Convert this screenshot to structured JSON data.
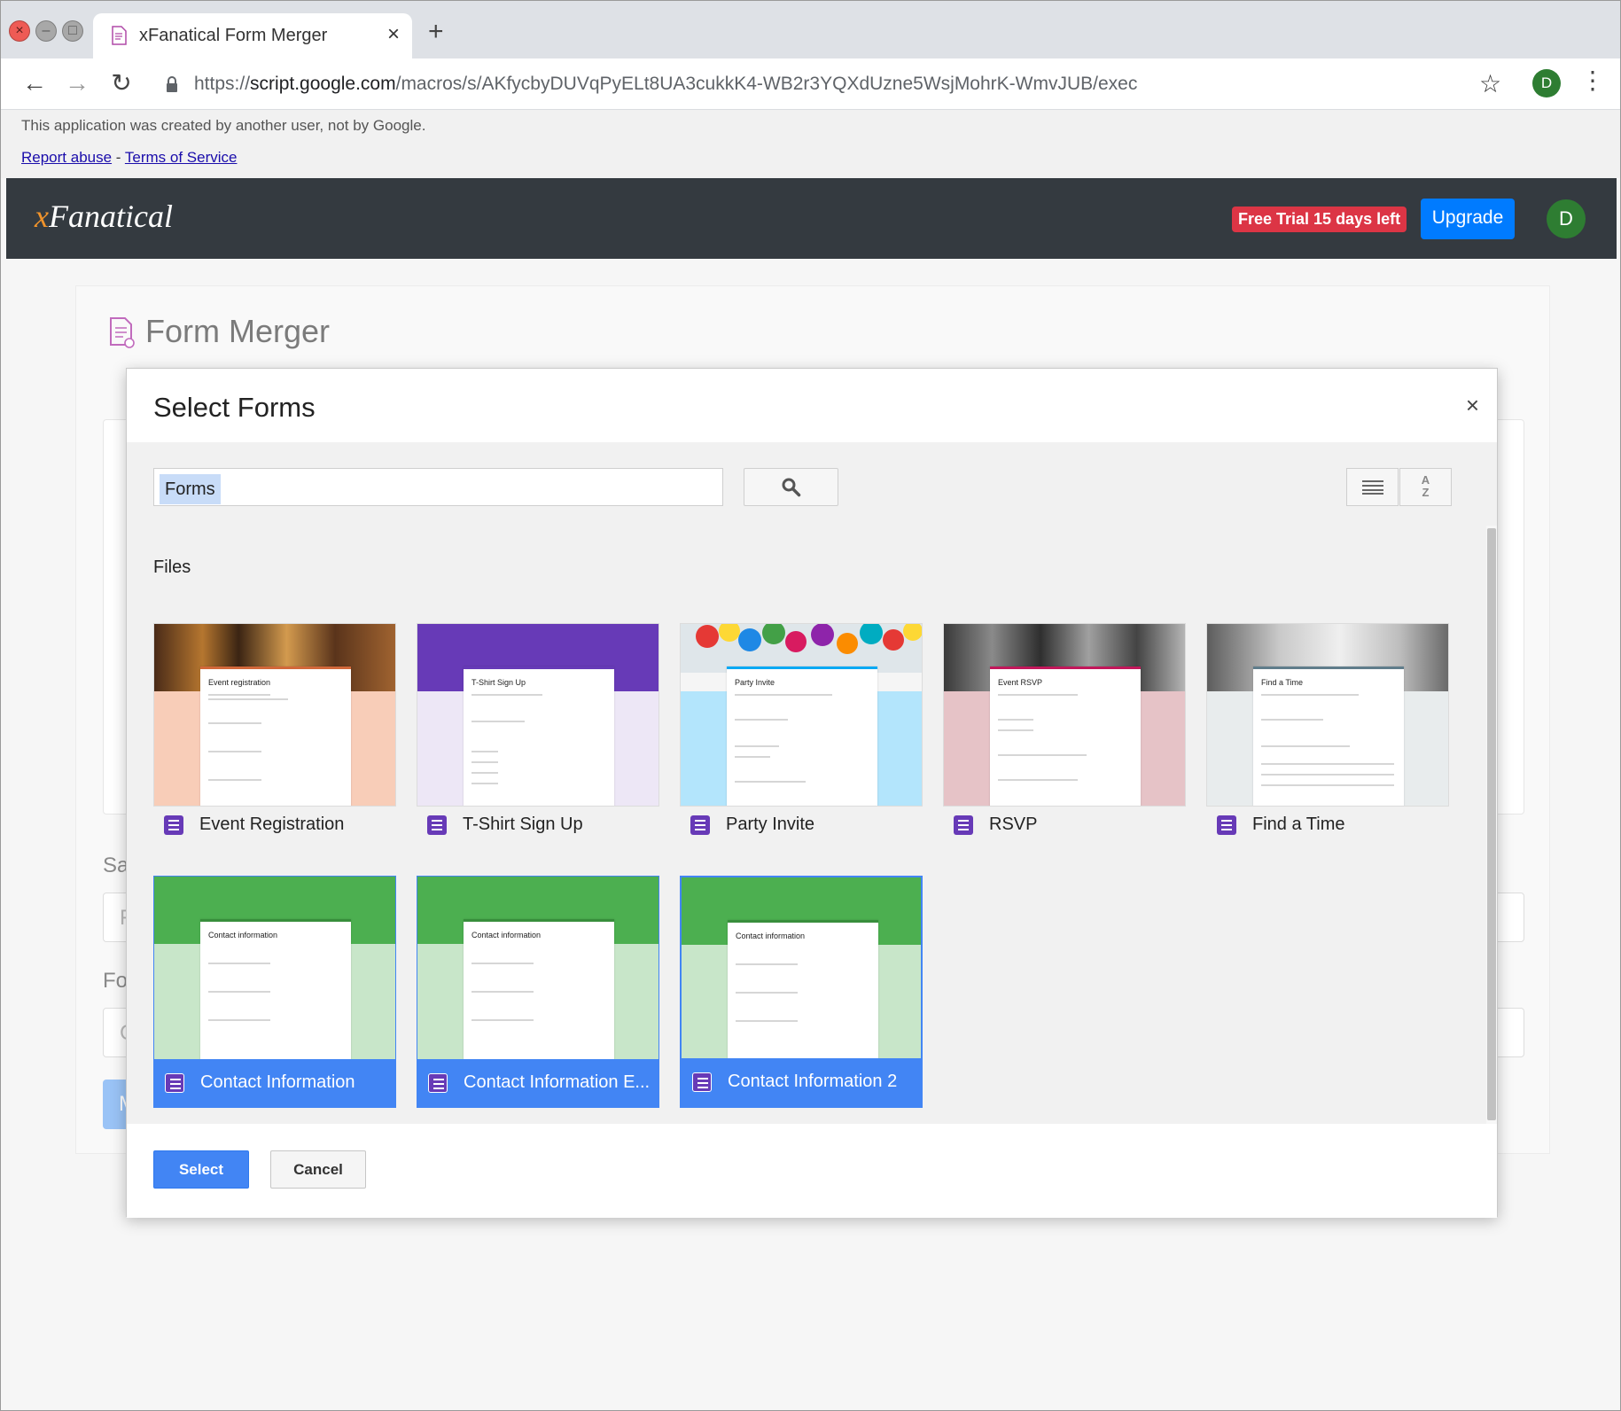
{
  "browser": {
    "tab_title": "xFanatical Form Merger",
    "url_scheme": "https://",
    "url_host": "script.google.com",
    "url_path": "/macros/s/AKfycbyDUVqPyELt8UA3cukkK4-WB2r3YQXdUzne5WsjMohrK-WmvJUB/exec",
    "profile_initial": "D"
  },
  "notice": {
    "text": "This application was created by another user, not by Google.",
    "report_abuse": "Report abuse",
    "separator": " - ",
    "terms": "Terms of Service"
  },
  "appbar": {
    "logo_x": "x",
    "logo_rest": "Fanatical",
    "trial_badge": "Free Trial 15 days left",
    "upgrade_label": "Upgrade",
    "avatar_initial": "D"
  },
  "page": {
    "title": "Form Merger",
    "label_1": "Sa",
    "label_2": "Fo",
    "input_1_hint": "F",
    "input_2_hint": "C",
    "button_hint": "M"
  },
  "modal": {
    "title": "Select Forms",
    "close_glyph": "×",
    "search_value": "Forms",
    "sort_label_top": "A",
    "sort_label_bottom": "Z",
    "section_label": "Files",
    "select_label": "Select",
    "cancel_label": "Cancel",
    "files": [
      {
        "name": "Event Registration",
        "preview_title": "Event registration",
        "selected": false
      },
      {
        "name": "T-Shirt Sign Up",
        "preview_title": "T-Shirt Sign Up",
        "selected": false
      },
      {
        "name": "Party Invite",
        "preview_title": "Party Invite",
        "selected": false
      },
      {
        "name": "RSVP",
        "preview_title": "Event RSVP",
        "selected": false
      },
      {
        "name": "Find a Time",
        "preview_title": "Find a Time",
        "selected": false
      },
      {
        "name": "Contact Information",
        "preview_title": "Contact information",
        "selected": true
      },
      {
        "name": "Contact Information E...",
        "preview_title": "Contact information",
        "selected": true
      },
      {
        "name": "Contact Information 2",
        "preview_title": "Contact information",
        "selected": true
      }
    ]
  },
  "colors": {
    "appbar_bg": "#343a40",
    "logo_accent": "#f0932b",
    "trial_red": "#dc3545",
    "upgrade_blue": "#007bff",
    "selection_blue": "#4285f4",
    "forms_purple": "#673ab7"
  }
}
